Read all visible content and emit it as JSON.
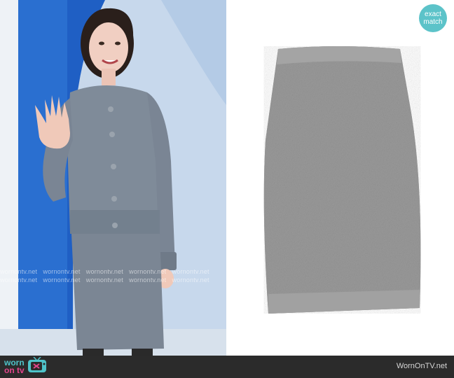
{
  "badge": {
    "line1": "exact",
    "line2": "match"
  },
  "watermark": {
    "text": "wornontv.net"
  },
  "footer": {
    "logo": {
      "part1": "worn",
      "part2": "on tv"
    },
    "site": "WornOnTV.net"
  },
  "icons": {
    "tv": "tv-icon"
  },
  "colors": {
    "accent": "#5cc3c9",
    "brand_pink": "#e4458b",
    "footer_bg": "#2b2b2b"
  }
}
